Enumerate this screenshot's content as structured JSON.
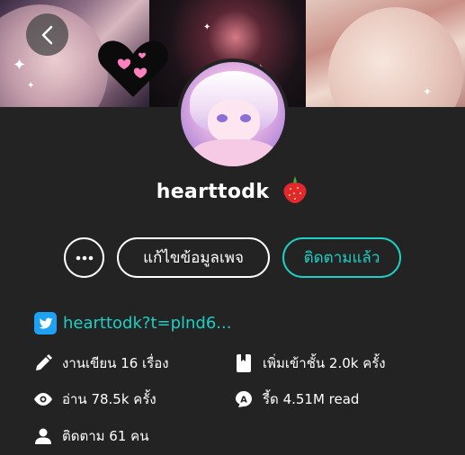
{
  "header": {
    "back_icon": "chevron-left-icon"
  },
  "profile": {
    "username": "hearttodk",
    "username_emoji_icon": "strawberry-icon"
  },
  "actions": {
    "more_icon": "ellipsis-icon",
    "edit_label": "แก้ไขข้อมูลเพจ",
    "follow_label": "ติดตามแล้ว"
  },
  "links": {
    "twitter_icon": "twitter-icon",
    "twitter_text": "hearttodk?t=plnd6..."
  },
  "stats": {
    "works": "งานเขียน 16 เรื่อง",
    "library_adds": "เพิ่มเข้าชั้น 2.0k ครั้ง",
    "reads": "อ่าน 78.5k ครั้ง",
    "readers": "รี้ด 4.51M read",
    "following": "ติดตาม 61 คน"
  },
  "colors": {
    "background": "#232323",
    "accent": "#1fcfc4",
    "twitter": "#1da1f2",
    "text": "#ffffff"
  }
}
